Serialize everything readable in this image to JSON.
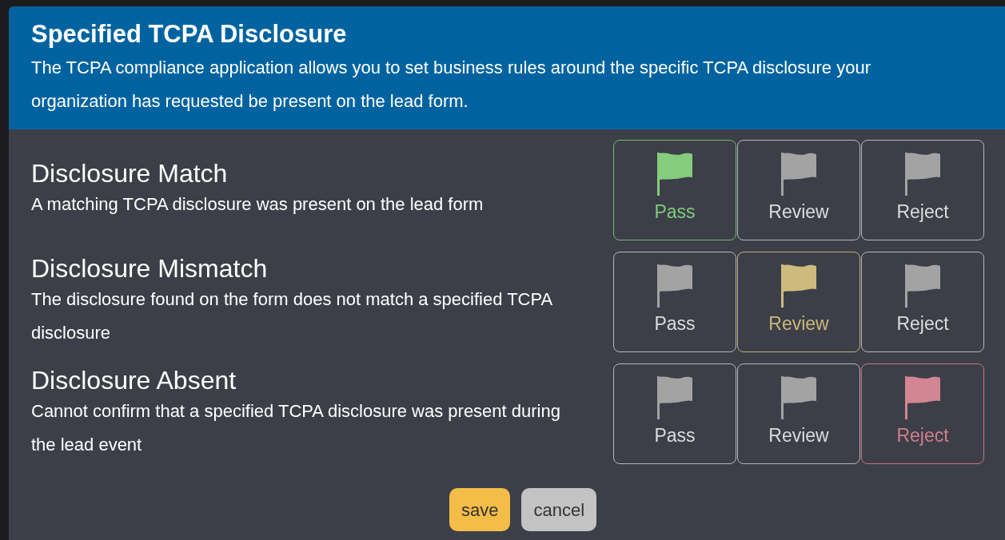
{
  "dialog": {
    "title": "Specified TCPA Disclosure",
    "description": "The TCPA compliance application allows you to set business rules around the specific TCPA disclosure your organization has requested be present on the lead form."
  },
  "rules": [
    {
      "title": "Disclosure Match",
      "description": "A matching TCPA disclosure was present on the lead form",
      "options": [
        {
          "kind": "pass",
          "label": "Pass",
          "selected": true
        },
        {
          "kind": "review",
          "label": "Review",
          "selected": false
        },
        {
          "kind": "reject",
          "label": "Reject",
          "selected": false
        }
      ]
    },
    {
      "title": "Disclosure Mismatch",
      "description": "The disclosure found on the form does not match a specified TCPA disclosure",
      "options": [
        {
          "kind": "pass",
          "label": "Pass",
          "selected": false
        },
        {
          "kind": "review",
          "label": "Review",
          "selected": true
        },
        {
          "kind": "reject",
          "label": "Reject",
          "selected": false
        }
      ]
    },
    {
      "title": "Disclosure Absent",
      "description": "Cannot confirm that a specified TCPA disclosure was present during the lead event",
      "options": [
        {
          "kind": "pass",
          "label": "Pass",
          "selected": false
        },
        {
          "kind": "review",
          "label": "Review",
          "selected": false
        },
        {
          "kind": "reject",
          "label": "Reject",
          "selected": true
        }
      ]
    }
  ],
  "buttons": [
    {
      "kind": "primary",
      "label": "save"
    },
    {
      "kind": "secondary",
      "label": "cancel"
    }
  ]
}
